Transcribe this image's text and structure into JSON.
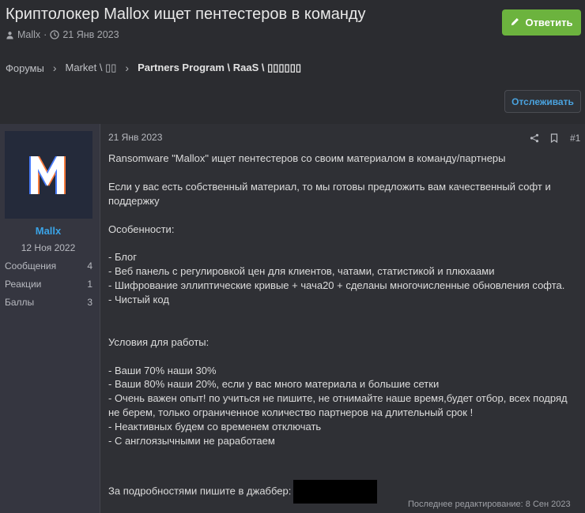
{
  "thread": {
    "title": "Криптолокер Mallox ищет пентестеров в команду",
    "author": "Mallx",
    "date": "21 Янв 2023",
    "reply_label": "Ответить",
    "follow_label": "Отслеживать"
  },
  "breadcrumb": {
    "items": [
      "Форумы",
      "Market \\ ▯▯",
      "Partners Program \\ RaaS \\ ▯▯▯▯▯▯"
    ]
  },
  "user": {
    "name": "Mallx",
    "joined": "12 Ноя 2022",
    "stats": [
      {
        "label": "Сообщения",
        "value": "4"
      },
      {
        "label": "Реакции",
        "value": "1"
      },
      {
        "label": "Баллы",
        "value": "3"
      }
    ]
  },
  "post": {
    "date": "21 Янв 2023",
    "number": "#1",
    "lines": [
      "Ransomware \"Mallox\" ищет пентестеров со своим материалом в команду/партнеры",
      "",
      "Если у вас есть собственный материал, то мы готовы предложить вам качественный софт и поддержку",
      "",
      "Особенности:",
      "",
      "- Блог",
      "- Веб панель с регулировкой цен для клиентов, чатами, статистикой и плюхаами",
      "- Шифрование эллиптические кривые + чача20 + сделаны многочисленные обновления софта.",
      "- Чистый код",
      "",
      "",
      "Условия для работы:",
      "",
      "- Ваши 70% наши 30%",
      "- Ваши 80% наши 20%, если у вас много материала и большие сетки",
      "- Очень важен опыт! по учиться не пишите, не отнимайте наше время,будет отбор, всех подряд не берем, только ограниченное количество партнеров на длительный срок !",
      "- Неактивных будем со временем отключать",
      "- С англоязычными не раработаем",
      "",
      ""
    ],
    "contact_label": "За подробностями пишите в джаббер:",
    "edited": "Последнее редактирование: 8 Сен 2023"
  },
  "colors": {
    "accent": "#3aa3e6",
    "reply": "#6cb33e"
  },
  "icons": [
    "user-icon",
    "clock-icon",
    "pencil-icon",
    "share-icon",
    "bookmark-icon",
    "chevron-right-icon"
  ]
}
